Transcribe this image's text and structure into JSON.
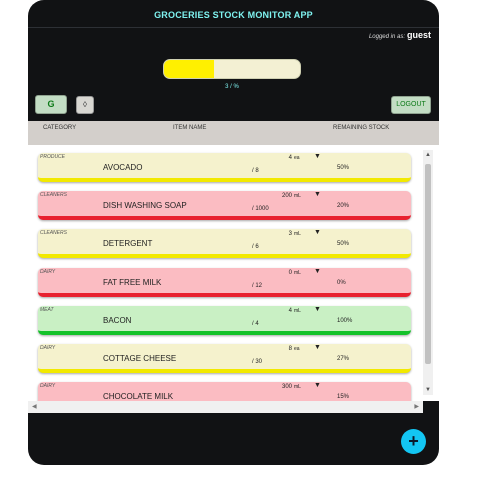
{
  "app": {
    "title": "GROCERIES STOCK MONITOR APP"
  },
  "user": {
    "prefix": "Logged in as:",
    "name": "guest"
  },
  "progress": {
    "fraction": 0.37,
    "label": "3 / %"
  },
  "toolbar": {
    "g_label": "G",
    "sort_label": "◊",
    "logout_label": "LOGOUT"
  },
  "table": {
    "headers": {
      "category": "CATEGORY",
      "item_name": "ITEM NAME",
      "remaining": "REMAINING STOCK"
    }
  },
  "items": [
    {
      "category": "PRODUCE",
      "name": "AVOCADO",
      "qty": "4",
      "unit": "ea",
      "total": "/ 8",
      "pct": "50%",
      "status": "ok"
    },
    {
      "category": "CLEANERS",
      "name": "DISH WASHING SOAP",
      "qty": "200",
      "unit": "mL",
      "total": "/ 1000",
      "pct": "20%",
      "status": "low"
    },
    {
      "category": "CLEANERS",
      "name": "DETERGENT",
      "qty": "3",
      "unit": "mL",
      "total": "/ 6",
      "pct": "50%",
      "status": "ok"
    },
    {
      "category": "DAIRY",
      "name": "FAT FREE MILK",
      "qty": "0",
      "unit": "mL",
      "total": "/ 12",
      "pct": "0%",
      "status": "low"
    },
    {
      "category": "MEAT",
      "name": "BACON",
      "qty": "4",
      "unit": "mL",
      "total": "/ 4",
      "pct": "100%",
      "status": "full"
    },
    {
      "category": "DAIRY",
      "name": "COTTAGE CHEESE",
      "qty": "8",
      "unit": "ea",
      "total": "/ 30",
      "pct": "27%",
      "status": "ok"
    },
    {
      "category": "DAIRY",
      "name": "CHOCOLATE MILK",
      "qty": "300",
      "unit": "mL",
      "total": "",
      "pct": "15%",
      "status": "low"
    }
  ],
  "fab": {
    "label": "+"
  },
  "colors": {
    "ok_bg": "#f5f2cd",
    "ok_bar": "#f2e900",
    "low_bg": "#fbbcc2",
    "low_bar": "#e8212f",
    "full_bg": "#c9f0c4",
    "full_bar": "#14c22a",
    "accent": "#7ff3f1",
    "fab": "#13c6f3"
  }
}
